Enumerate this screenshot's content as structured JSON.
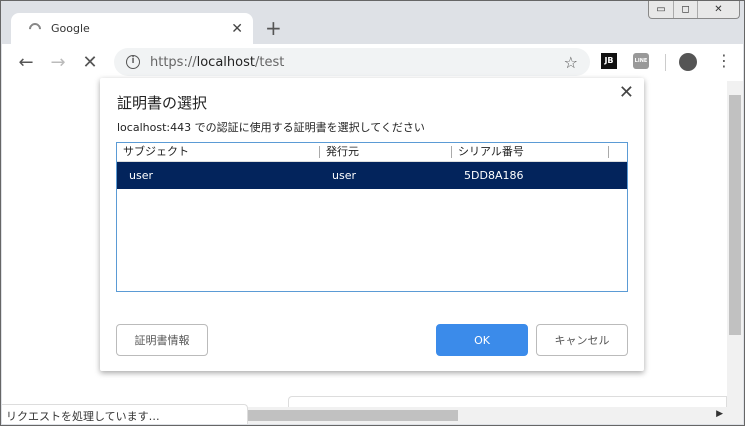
{
  "browser": {
    "tab_title": "Google",
    "url_prefix": "https://",
    "url_host": "localhost",
    "url_path": "/test",
    "ext1": "JB",
    "ext2": "LINE"
  },
  "dialog": {
    "title": "証明書の選択",
    "description": "localhost:443 での認証に使用する証明書を選択してください",
    "columns": [
      "サブジェクト",
      "発行元",
      "シリアル番号"
    ],
    "rows": [
      {
        "subject": "user",
        "issuer": "user",
        "serial": "5DD8A186"
      }
    ],
    "cert_info_label": "証明書情報",
    "ok_label": "OK",
    "cancel_label": "キャンセル"
  },
  "status": "リクエストを処理しています…"
}
